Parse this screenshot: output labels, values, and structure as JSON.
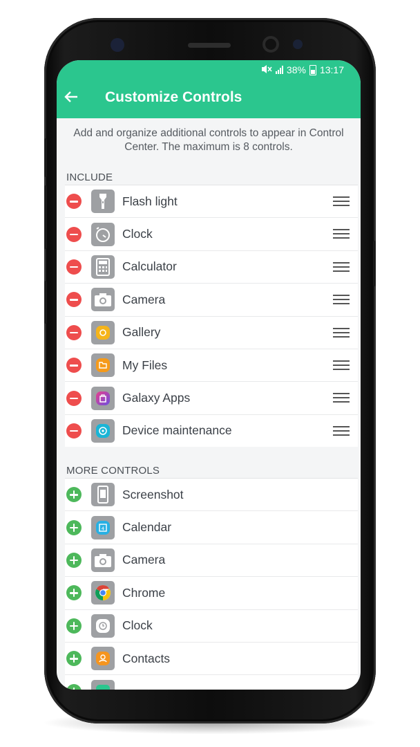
{
  "status": {
    "battery": "38%",
    "time": "13:17"
  },
  "header": {
    "title": "Customize Controls"
  },
  "description": "Add and organize additional controls to appear in Control Center. The maximum is 8 controls.",
  "include": {
    "heading": "INCLUDE",
    "items": [
      {
        "label": "Flash light",
        "icon": "flashlight-icon"
      },
      {
        "label": "Clock",
        "icon": "timer-icon"
      },
      {
        "label": "Calculator",
        "icon": "calculator-icon"
      },
      {
        "label": "Camera",
        "icon": "camera-icon"
      },
      {
        "label": "Gallery",
        "icon": "gallery-icon"
      },
      {
        "label": "My Files",
        "icon": "folder-icon"
      },
      {
        "label": "Galaxy Apps",
        "icon": "store-bag-icon"
      },
      {
        "label": "Device maintenance",
        "icon": "maintenance-icon"
      }
    ]
  },
  "more": {
    "heading": "MORE CONTROLS",
    "items": [
      {
        "label": "Screenshot",
        "icon": "phone-screenshot-icon"
      },
      {
        "label": "Calendar",
        "icon": "calendar-icon"
      },
      {
        "label": "Camera",
        "icon": "camera-icon"
      },
      {
        "label": "Chrome",
        "icon": "chrome-icon"
      },
      {
        "label": "Clock",
        "icon": "clock-icon"
      },
      {
        "label": "Contacts",
        "icon": "contacts-icon"
      },
      {
        "label": "",
        "icon": "app-icon"
      }
    ]
  },
  "colors": {
    "accent": "#2bc68e",
    "remove": "#ee4d4d",
    "add": "#4db85b"
  }
}
